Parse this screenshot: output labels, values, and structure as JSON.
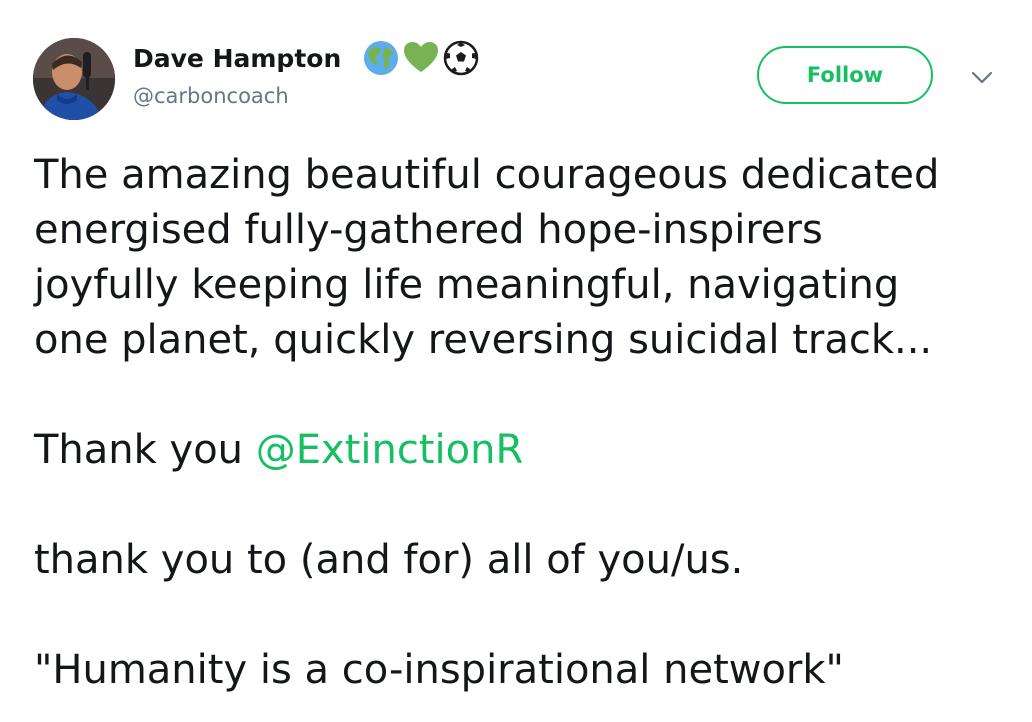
{
  "author": {
    "name": "Dave Hampton",
    "handle": "@carboncoach",
    "name_emojis": [
      "earth-globe-icon",
      "green-heart-icon",
      "soccer-ball-icon"
    ]
  },
  "follow_button": {
    "label": "Follow"
  },
  "menu": {
    "icon": "chevron-down-icon"
  },
  "tweet": {
    "paragraph1": [
      "The amazing beautiful courageous dedicated",
      "energised fully-gathered hope-inspirers",
      "joyfully keeping life meaningful, navigating",
      "one planet, quickly reversing suicidal track..."
    ],
    "paragraph2": {
      "prefix": "Thank you ",
      "mention": "@ExtinctionR"
    },
    "paragraph3": "thank you to (and for) all of you/us.",
    "paragraph4": "\"Humanity is a co-inspirational network\""
  },
  "colors": {
    "accent": "#17bf63",
    "text": "#14171a",
    "secondary": "#657786"
  }
}
